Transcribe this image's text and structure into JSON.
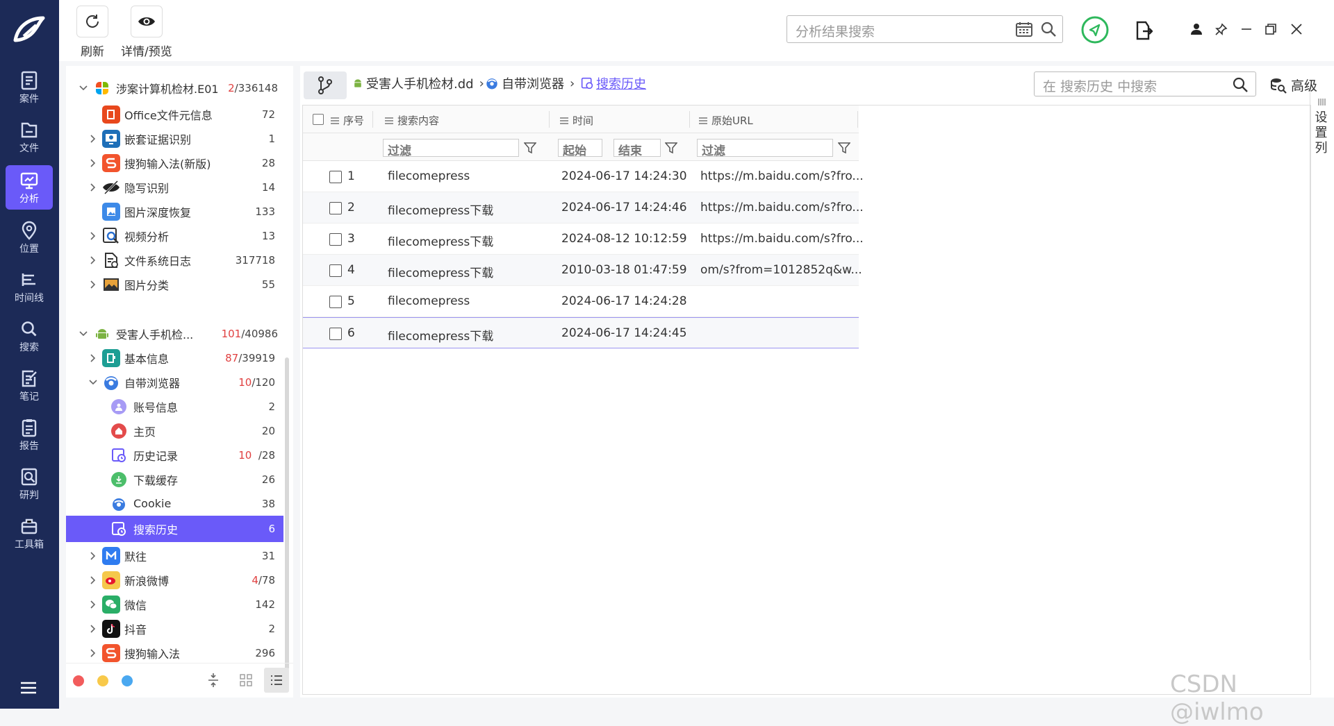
{
  "nav": {
    "items": [
      {
        "label": "案件",
        "icon": "case-icon"
      },
      {
        "label": "文件",
        "icon": "folder-icon"
      },
      {
        "label": "分析",
        "icon": "analysis-icon",
        "active": true
      },
      {
        "label": "位置",
        "icon": "location-icon"
      },
      {
        "label": "时间线",
        "icon": "timeline-icon"
      },
      {
        "label": "搜索",
        "icon": "search-icon"
      },
      {
        "label": "笔记",
        "icon": "note-icon"
      },
      {
        "label": "报告",
        "icon": "report-icon"
      },
      {
        "label": "研判",
        "icon": "judge-icon"
      },
      {
        "label": "工具箱",
        "icon": "toolbox-icon"
      }
    ]
  },
  "toolbar": {
    "refresh_label": "刷新",
    "detail_label": "详情/预览",
    "search_placeholder": "分析结果搜索"
  },
  "tree": {
    "root1": {
      "label": "涉案计算机检材.E01",
      "count_red": "2",
      "count_total": "/336148"
    },
    "items1": [
      {
        "label": "Office文件元信息",
        "count": "72"
      },
      {
        "label": "嵌套证据识别",
        "count": "1"
      },
      {
        "label": "搜狗输入法(新版)",
        "count": "28"
      },
      {
        "label": "隐写识别",
        "count": "14"
      },
      {
        "label": "图片深度恢复",
        "count": "133"
      },
      {
        "label": "视频分析",
        "count": "13"
      },
      {
        "label": "文件系统日志",
        "count": "317718"
      },
      {
        "label": "图片分类",
        "count": "55"
      }
    ],
    "root2": {
      "label": "受害人手机检...",
      "count_red": "101",
      "count_total": "/40986"
    },
    "basic": {
      "label": "基本信息",
      "count_red": "87",
      "count_total": "/39919"
    },
    "browser": {
      "label": "自带浏览器",
      "count_red": "10",
      "count_total": "/120"
    },
    "browser_children": [
      {
        "label": "账号信息",
        "count": "2"
      },
      {
        "label": "主页",
        "count": "20"
      },
      {
        "label": "历史记录",
        "count_red": "10",
        "count_total": "/28"
      },
      {
        "label": "下载缓存",
        "count": "26"
      },
      {
        "label": "Cookie",
        "count": "38"
      },
      {
        "label": "搜索历史",
        "count": "6"
      }
    ],
    "items2": [
      {
        "label": "默往",
        "count": "31"
      },
      {
        "label": "新浪微博",
        "count_red": "4",
        "count_total": "/78"
      },
      {
        "label": "微信",
        "count": "142"
      },
      {
        "label": "抖音",
        "count": "2"
      },
      {
        "label": "搜狗输入法",
        "count": "296"
      }
    ]
  },
  "breadcrumb": {
    "device": "受害人手机检材.dd",
    "app": "自带浏览器",
    "current": "搜索历史"
  },
  "content_search": {
    "placeholder": "在 搜索历史 中搜索",
    "advanced_label": "高级"
  },
  "grid": {
    "headers": {
      "index": "序号",
      "content": "搜索内容",
      "time": "时间",
      "url": "原始URL"
    },
    "filters": {
      "filter": "过滤",
      "start": "起始",
      "end": "结束"
    },
    "rows": [
      {
        "index": "1",
        "content": "filecomepress",
        "time": "2024-06-17 14:24:30",
        "url": "https://m.baidu.com/s?fro..."
      },
      {
        "index": "2",
        "content": "filecomepress下载",
        "time": "2024-06-17 14:24:46",
        "url": "https://m.baidu.com/s?fro..."
      },
      {
        "index": "3",
        "content": "filecomepress下载",
        "time": "2024-08-12 10:12:59",
        "url": "https://m.baidu.com/s?fro..."
      },
      {
        "index": "4",
        "content": "filecomepress下载",
        "time": "2010-03-18 01:47:59",
        "url": "om/s?from=1012852q&w..."
      },
      {
        "index": "5",
        "content": "filecomepress",
        "time": "2024-06-17 14:24:28",
        "url": ""
      },
      {
        "index": "6",
        "content": "filecomepress下载",
        "time": "2024-06-17 14:24:45",
        "url": ""
      }
    ],
    "settings_col": [
      "设",
      "置",
      "列"
    ]
  },
  "colors": {
    "nav_bg": "#1c2a57",
    "accent": "#6a5af9",
    "red": "#e04040"
  },
  "watermark": "CSDN @iwlmo"
}
